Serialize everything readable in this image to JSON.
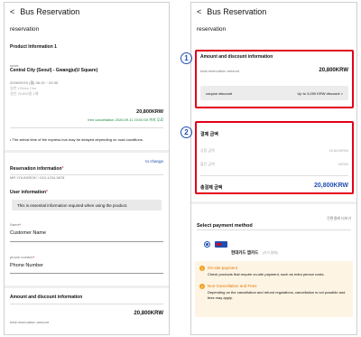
{
  "left": {
    "header": {
      "back": "<",
      "title": "Bus Reservation"
    },
    "subtitle": "reservation",
    "product": {
      "section_title": "Product Information 1",
      "route_small": "seats",
      "route": "Central City (Seoul) - Gwangju(U Square)",
      "datetime": "2026/09/19 (월) 06:15 ~ 09:35",
      "seat_line1": "일반 1Dinkn Cen",
      "seat_line2": "성인 20,800원 1매",
      "price": "20,800KRW",
      "cancel_note": "free cancellation 2026.09.11 23:00:00 까지 무료",
      "notice": "The arrival time of the express bus may be delayed depending on road conditions."
    },
    "reservation": {
      "title": "Reservation information",
      "star": "*",
      "detail": "MR YOUNSEOK / 010-1234-5678",
      "change": "to change"
    },
    "user": {
      "title": "User information",
      "star": "*",
      "notice": "This is essential information required when using the product.",
      "name_label": "Name",
      "name_star": "*",
      "name_value": "Customer Name",
      "phone_label": "phone number",
      "phone_star": "*",
      "phone_value": "Phone Number"
    },
    "amount": {
      "title": "Amount and discount information",
      "label": "total reservation amount",
      "value": "20,800KRW"
    }
  },
  "right": {
    "header": {
      "back": "<",
      "title": "Bus Reservation"
    },
    "subtitle": "reservation",
    "callout1": "1",
    "callout2": "2",
    "amount": {
      "title": "Amount and discount information",
      "label": "total reservation amount",
      "value": "20,800KRW",
      "coupon_label": "coupon discount",
      "coupon_value": "Up to 3,000 KRW discount",
      "coupon_arrow": ">"
    },
    "payment": {
      "title": "결제 금액",
      "row1_label": "상품 금액",
      "row1_value": "20,800KRW",
      "row2_label": "할인 금액",
      "row2_value": "0KRW",
      "total_label": "총결제 금액",
      "total_value": "20,800KRW"
    },
    "method": {
      "title": "Select payment method",
      "link": "간편결제 더보기",
      "option_name": "현대카드 앱카드",
      "option_sub": "(카드결제)"
    },
    "info": {
      "onsite_title": "On-site payment",
      "onsite_text": "Check products that require on-site payment, such as extra person costs.",
      "cancel_title": "Non-Cancellation and Fees",
      "cancel_text": "Depending on the cancellation and refund regulations, cancellation is not possible and fees may apply."
    }
  },
  "colors": {
    "highlight": "#e2001a",
    "accent": "#1f4fb0",
    "green": "#1a8a3a"
  }
}
